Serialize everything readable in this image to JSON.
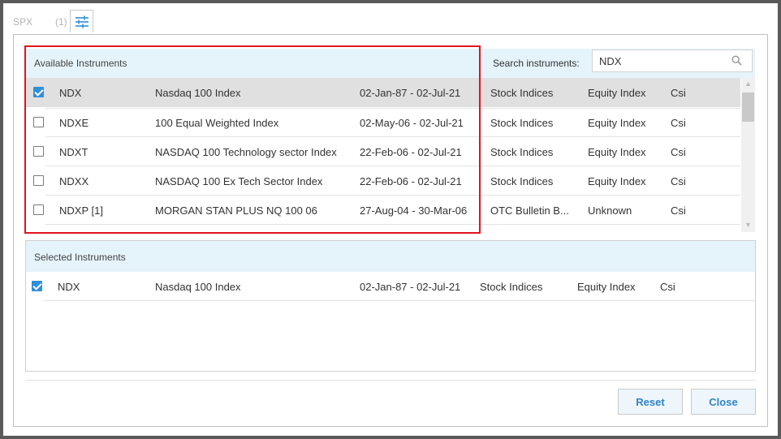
{
  "top_bar": {
    "tab_label": "SPX",
    "tab_count": "(1)",
    "settings_icon": "sliders-icon"
  },
  "available": {
    "title": "Available Instruments",
    "rows": [
      {
        "checked": true,
        "symbol": "NDX",
        "name": "Nasdaq 100 Index",
        "range": "02-Jan-87 - 02-Jul-21",
        "category": "Stock Indices",
        "type": "Equity Index",
        "source": "Csi"
      },
      {
        "checked": false,
        "symbol": "NDXE",
        "name": "100 Equal Weighted Index",
        "range": "02-May-06 - 02-Jul-21",
        "category": "Stock Indices",
        "type": "Equity Index",
        "source": "Csi"
      },
      {
        "checked": false,
        "symbol": "NDXT",
        "name": "NASDAQ 100 Technology sector Index",
        "range": "22-Feb-06 - 02-Jul-21",
        "category": "Stock Indices",
        "type": "Equity Index",
        "source": "Csi"
      },
      {
        "checked": false,
        "symbol": "NDXX",
        "name": "NASDAQ 100 Ex Tech Sector Index",
        "range": "22-Feb-06 - 02-Jul-21",
        "category": "Stock Indices",
        "type": "Equity Index",
        "source": "Csi"
      },
      {
        "checked": false,
        "symbol": "NDXP [1]",
        "name": "MORGAN STAN PLUS NQ 100 06",
        "range": "27-Aug-04 - 30-Mar-06",
        "category": "OTC Bulletin B...",
        "type": "Unknown",
        "source": "Csi"
      }
    ]
  },
  "search": {
    "label": "Search instruments:",
    "value": "NDX",
    "placeholder": ""
  },
  "selected": {
    "title": "Selected Instruments",
    "rows": [
      {
        "checked": true,
        "symbol": "NDX",
        "name": "Nasdaq 100 Index",
        "range": "02-Jan-87 - 02-Jul-21",
        "category": "Stock Indices",
        "type": "Equity Index",
        "source": "Csi"
      }
    ]
  },
  "buttons": {
    "reset": "Reset",
    "close": "Close"
  },
  "colors": {
    "accent": "#2f8fd8",
    "header_bg": "#e5f3fa",
    "highlight": "#e0141e",
    "selected_row": "#e0e0e0"
  }
}
